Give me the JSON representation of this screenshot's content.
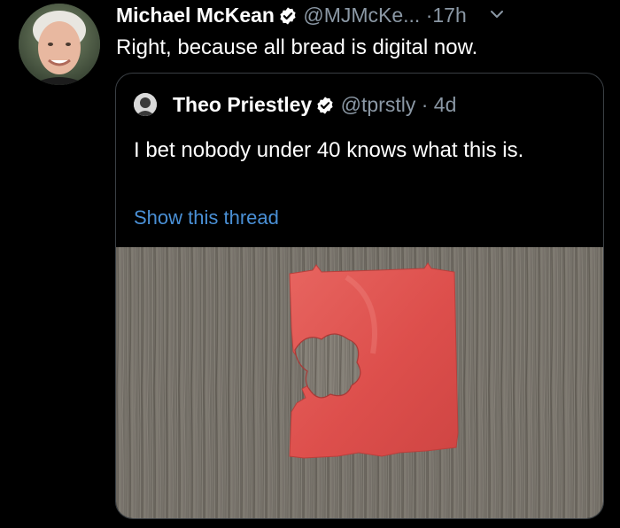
{
  "tweet": {
    "author_name": "Michael McKean",
    "handle": "@MJMcKe...",
    "separator": "·",
    "time": "17h",
    "text": "Right, because all bread is digital now."
  },
  "quoted_tweet": {
    "author_name": "Theo Priestley",
    "handle": "@tprstly",
    "separator": "·",
    "time": "4d",
    "text": "I bet nobody under 40 knows what this is.",
    "show_thread_label": "Show this thread"
  },
  "colors": {
    "background": "#000000",
    "text_primary": "#ffffff",
    "text_secondary": "#8b98a5",
    "link": "#4a90d6",
    "verified": "#ffffff",
    "quote_border": "#3a3f44",
    "bread_clip": "#e0524f"
  },
  "icons": {
    "verified": "verified-badge-icon",
    "caret": "chevron-down-icon"
  }
}
